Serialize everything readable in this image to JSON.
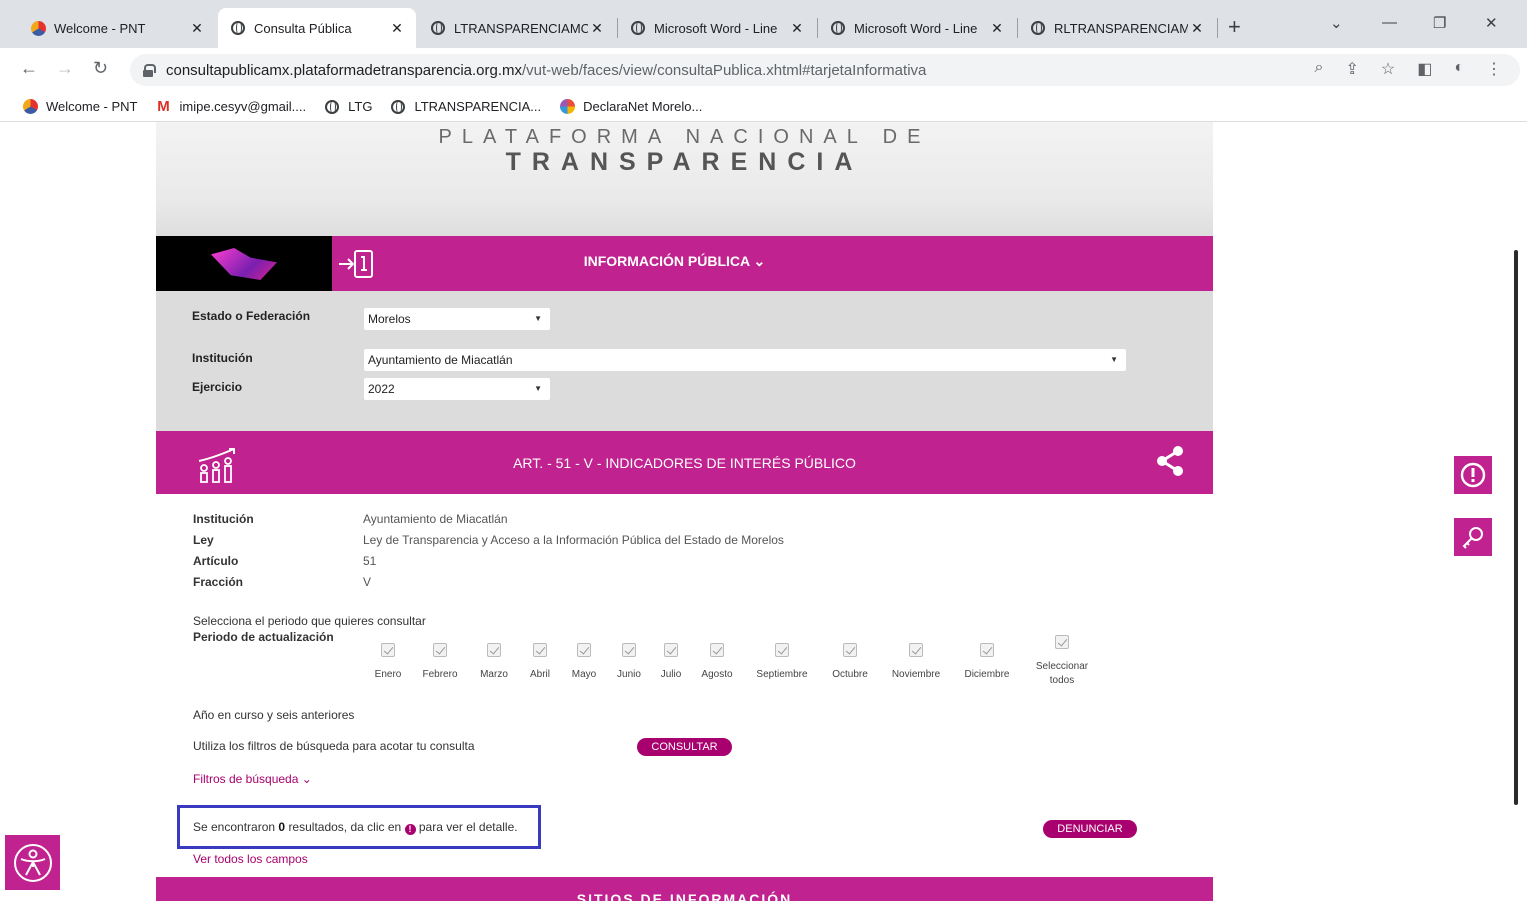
{
  "browser": {
    "tabs": [
      {
        "title": "Welcome - PNT",
        "active": false,
        "icon": "pnt-logo-icon"
      },
      {
        "title": "Consulta Pública",
        "active": true,
        "icon": "globe-icon"
      },
      {
        "title": "LTRANSPARENCIAMC",
        "active": false,
        "icon": "globe-icon"
      },
      {
        "title": "Microsoft Word - Line",
        "active": false,
        "icon": "globe-icon"
      },
      {
        "title": "Microsoft Word - Line",
        "active": false,
        "icon": "globe-icon"
      },
      {
        "title": "RLTRANSPARENCIAM",
        "active": false,
        "icon": "globe-icon"
      }
    ],
    "url_host": "consultapublicamx.plataformadetransparencia.org.mx",
    "url_path": "/vut-web/faces/view/consultaPublica.xhtml#tarjetaInformativa",
    "bookmarks": [
      {
        "label": "Welcome - PNT",
        "icon": "pnt-logo-icon"
      },
      {
        "label": "imipe.cesyv@gmail....",
        "icon": "gmail-icon"
      },
      {
        "label": "LTG",
        "icon": "globe-icon"
      },
      {
        "label": "LTRANSPARENCIA...",
        "icon": "globe-icon"
      },
      {
        "label": "DeclaraNet Morelo...",
        "icon": "declaranet-icon"
      }
    ]
  },
  "banner": {
    "line1": "PLATAFORMA NACIONAL DE",
    "line2": "TRANSPARENCIA"
  },
  "infobar": {
    "title": "INFORMACIÓN PÚBLICA ⌄"
  },
  "filters": {
    "estado_label": "Estado o Federación",
    "estado_value": "Morelos",
    "institucion_label": "Institución",
    "institucion_value": "Ayuntamiento de Miacatlán",
    "ejercicio_label": "Ejercicio",
    "ejercicio_value": "2022"
  },
  "section": {
    "title": "ART. - 51 - V - INDICADORES DE INTERÉS PÚBLICO"
  },
  "details": {
    "institucion_label": "Institución",
    "institucion_value": "Ayuntamiento de Miacatlán",
    "ley_label": "Ley",
    "ley_value": "Ley de Transparencia y Acceso a la Información Pública del Estado de Morelos",
    "articulo_label": "Artículo",
    "articulo_value": "51",
    "fraccion_label": "Fracción",
    "fraccion_value": "V"
  },
  "period": {
    "prompt": "Selecciona el periodo que quieres consultar",
    "label": "Periodo de actualización",
    "months": [
      "Enero",
      "Febrero",
      "Marzo",
      "Abril",
      "Mayo",
      "Junio",
      "Julio",
      "Agosto",
      "Septiembre",
      "Octubre",
      "Noviembre",
      "Diciembre"
    ],
    "select_all_line1": "Seleccionar",
    "select_all_line2": "todos"
  },
  "search": {
    "years_note": "Año en curso y seis anteriores",
    "filters_note": "Utiliza los filtros de búsqueda para acotar tu consulta",
    "consult_button": "CONSULTAR",
    "filters_link": "Filtros de búsqueda ⌄",
    "results_prefix": "Se encontraron",
    "results_count": "0",
    "results_mid": "resultados, da clic en",
    "results_suffix": "para ver el detalle.",
    "report_button": "DENUNCIAR",
    "all_fields_link": "Ver todos los campos"
  },
  "footer": {
    "title": "SITIOS DE INFORMACIÓN"
  },
  "colors": {
    "brand": "#c0228f",
    "brand_dark": "#a8006e",
    "highlight_box": "#3a3ac0"
  }
}
